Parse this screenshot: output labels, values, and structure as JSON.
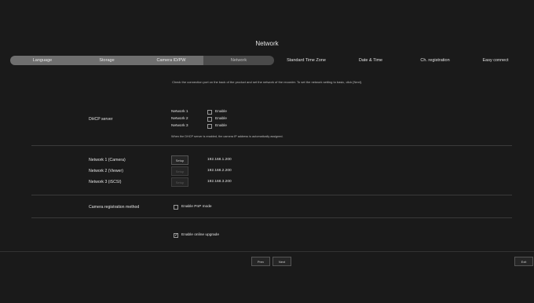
{
  "page": {
    "title": "Network"
  },
  "tabs": [
    {
      "label": "Language",
      "state": "done"
    },
    {
      "label": "Storage",
      "state": "done"
    },
    {
      "label": "Camera ID/PW",
      "state": "done"
    },
    {
      "label": "Network",
      "state": "active"
    },
    {
      "label": "Standard Time Zone",
      "state": "upcoming"
    },
    {
      "label": "Date & Time",
      "state": "upcoming"
    },
    {
      "label": "Ch. registration",
      "state": "upcoming"
    },
    {
      "label": "Easy connect",
      "state": "upcoming"
    }
  ],
  "info_text": "Check the connection port on the back of the product and set the network of the recorder. To set the network setting to basic, click [Next].",
  "dhcp": {
    "section_label": "DHCP server",
    "networks": [
      {
        "name": "Network 1",
        "enable_label": "Enable",
        "checked": false
      },
      {
        "name": "Network 2",
        "enable_label": "Enable",
        "checked": false
      },
      {
        "name": "Network 3",
        "enable_label": "Enable",
        "checked": false
      }
    ],
    "note": "When the DHCP server is enabled, the camera IP address is automatically assigned."
  },
  "network_setup": [
    {
      "label": "Network 1 (Camera)",
      "button": "Setup",
      "enabled": true,
      "ip": "192.168.1.200"
    },
    {
      "label": "Network 2 (Viewer)",
      "button": "Setup",
      "enabled": false,
      "ip": "192.168.2.200"
    },
    {
      "label": "Network 3 (iSCSI)",
      "button": "Setup",
      "enabled": false,
      "ip": "192.168.3.200"
    }
  ],
  "registration": {
    "label": "Camera registration method",
    "option_label": "Enable PnP mode",
    "checked": false
  },
  "upgrade": {
    "option_label": "Enable online upgrade",
    "checked": true
  },
  "footer": {
    "prev_label": "Prev",
    "next_label": "Next",
    "exit_label": "Exit"
  }
}
